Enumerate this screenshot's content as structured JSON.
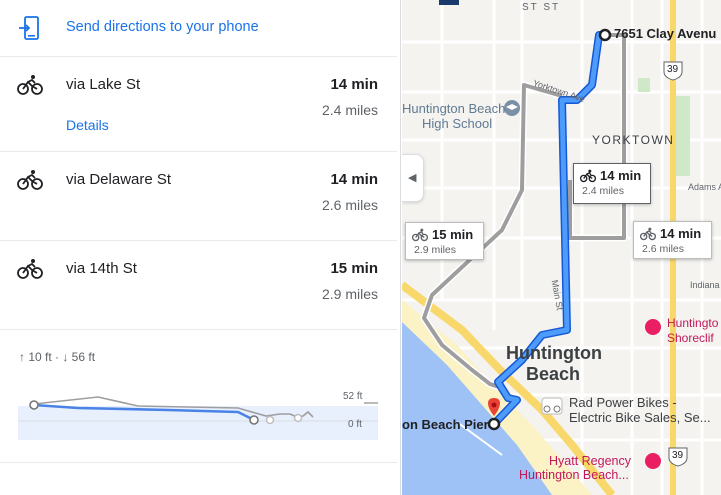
{
  "panel": {
    "send_label": "Send directions to your phone",
    "routes": [
      {
        "via": "via Lake St",
        "time": "14 min",
        "distance": "2.4 miles",
        "details": "Details"
      },
      {
        "via": "via Delaware St",
        "time": "14 min",
        "distance": "2.6 miles"
      },
      {
        "via": "via 14th St",
        "time": "15 min",
        "distance": "2.9 miles"
      }
    ],
    "elevation": {
      "summary": "↑ 10 ft · ↓ 56 ft",
      "max_label": "52 ft",
      "min_label": "0 ft"
    }
  },
  "map": {
    "destination_label": "7651 Clay Avenu",
    "start_label": "on Beach Pier",
    "city_line1": "Huntington",
    "city_line2": "Beach",
    "neighborhood": "YORKTOWN",
    "school_line1": "Huntington Beach",
    "school_line2": "High School",
    "street_yorktown": "Yorktown Ave",
    "street_main": "Main St",
    "street_adams": "Adams A",
    "street_indiana": "Indiana",
    "street_top": "ST ST",
    "poi_bikes_line1": "Rad Power Bikes -",
    "poi_bikes_line2": "Electric Bike Sales, Se...",
    "poi_shoreclift_line1": "Huntingto",
    "poi_shoreclift_line2": "Shoreclif",
    "poi_hyatt_line1": "Hyatt Regency",
    "poi_hyatt_line2": "Huntington Beach...",
    "route_shield_1": "39",
    "route_shield_2": "39",
    "callouts": [
      {
        "time": "14 min",
        "distance": "2.4 miles"
      },
      {
        "time": "15 min",
        "distance": "2.9 miles"
      },
      {
        "time": "14 min",
        "distance": "2.6 miles"
      }
    ],
    "colors": {
      "active_route": "#1a73e8",
      "alt_route": "#9e9e9e",
      "water": "#9ec2f5",
      "beach": "#fbf2c5",
      "highway": "#f9d86b"
    }
  }
}
